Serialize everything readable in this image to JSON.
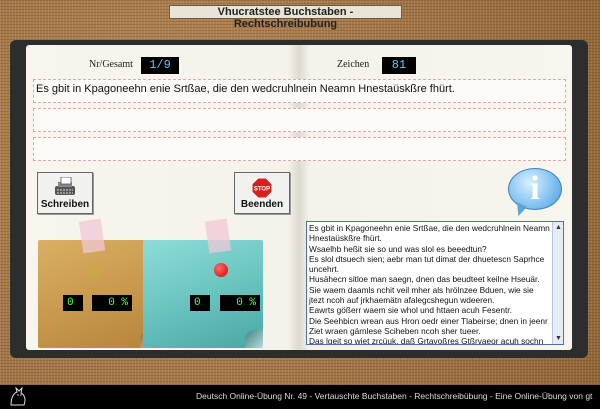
{
  "window_title": "Vhucratstee Buchstaben - Rechtschreibubung",
  "counters": {
    "nr_label": "Nr/Gesamt",
    "nr_value": "1/9",
    "zeichen_label": "Zeichen",
    "zeichen_value": "81"
  },
  "lines": [
    "Es gbit in Kpagoneehn enie Srtßae, die den wedcruhlnein Neamn Hnestaüskßre fhürt.",
    "",
    ""
  ],
  "buttons": {
    "write_label": "Schreiben",
    "stop_label": "Beenden",
    "stop_sign": "STOP"
  },
  "scores": {
    "yellow_count": "0",
    "yellow_percent": "0 %",
    "teal_count": "0",
    "teal_percent": "0 %"
  },
  "info_glyph": "i",
  "panel_text": "Es gbit in Kpagoneehn enie Srtßae, die den wedcruhlnein Neamn Hnestaüskßre fhürt.\nWsaelhb heßit sie so und was slol es beeedtun?\nEs slol dtsuech sien; aebr man tut dimat der dhuetescn Saprhce uncehrt.\nHusähecn sitloe man saegn, dnen das beudteet keilne Hseuär.\nSie waem daamls nchit veil mher als hrölnzee Bduen, wie sie jtezt ncoh auf jrkhaemätn afalegcshegun wdeeren.\nEawrts gößerr waem sie whol und httaen acuh Fesentr.\nDie Seehbicn wrean aus Hron oedr einer Tlabeirse; dnen in jeenr Ziet wraen gärnlese Sciheben ncoh sher tueer.\nDas lgeit so wiet zrcüuk, daß Grtavoßres Gtßrvaeor acuh sochn in ateln Tgean sqtae.",
  "footer_text": "Deutsch Online-Übung Nr. 49 - Vertauschte Buchstaben - Rechtschreibübung - Eine Online-Übung von gt",
  "colors": {
    "counter_text": "#58c8ff",
    "score_text": "#55ff55",
    "stop_red": "#d81f1f"
  }
}
